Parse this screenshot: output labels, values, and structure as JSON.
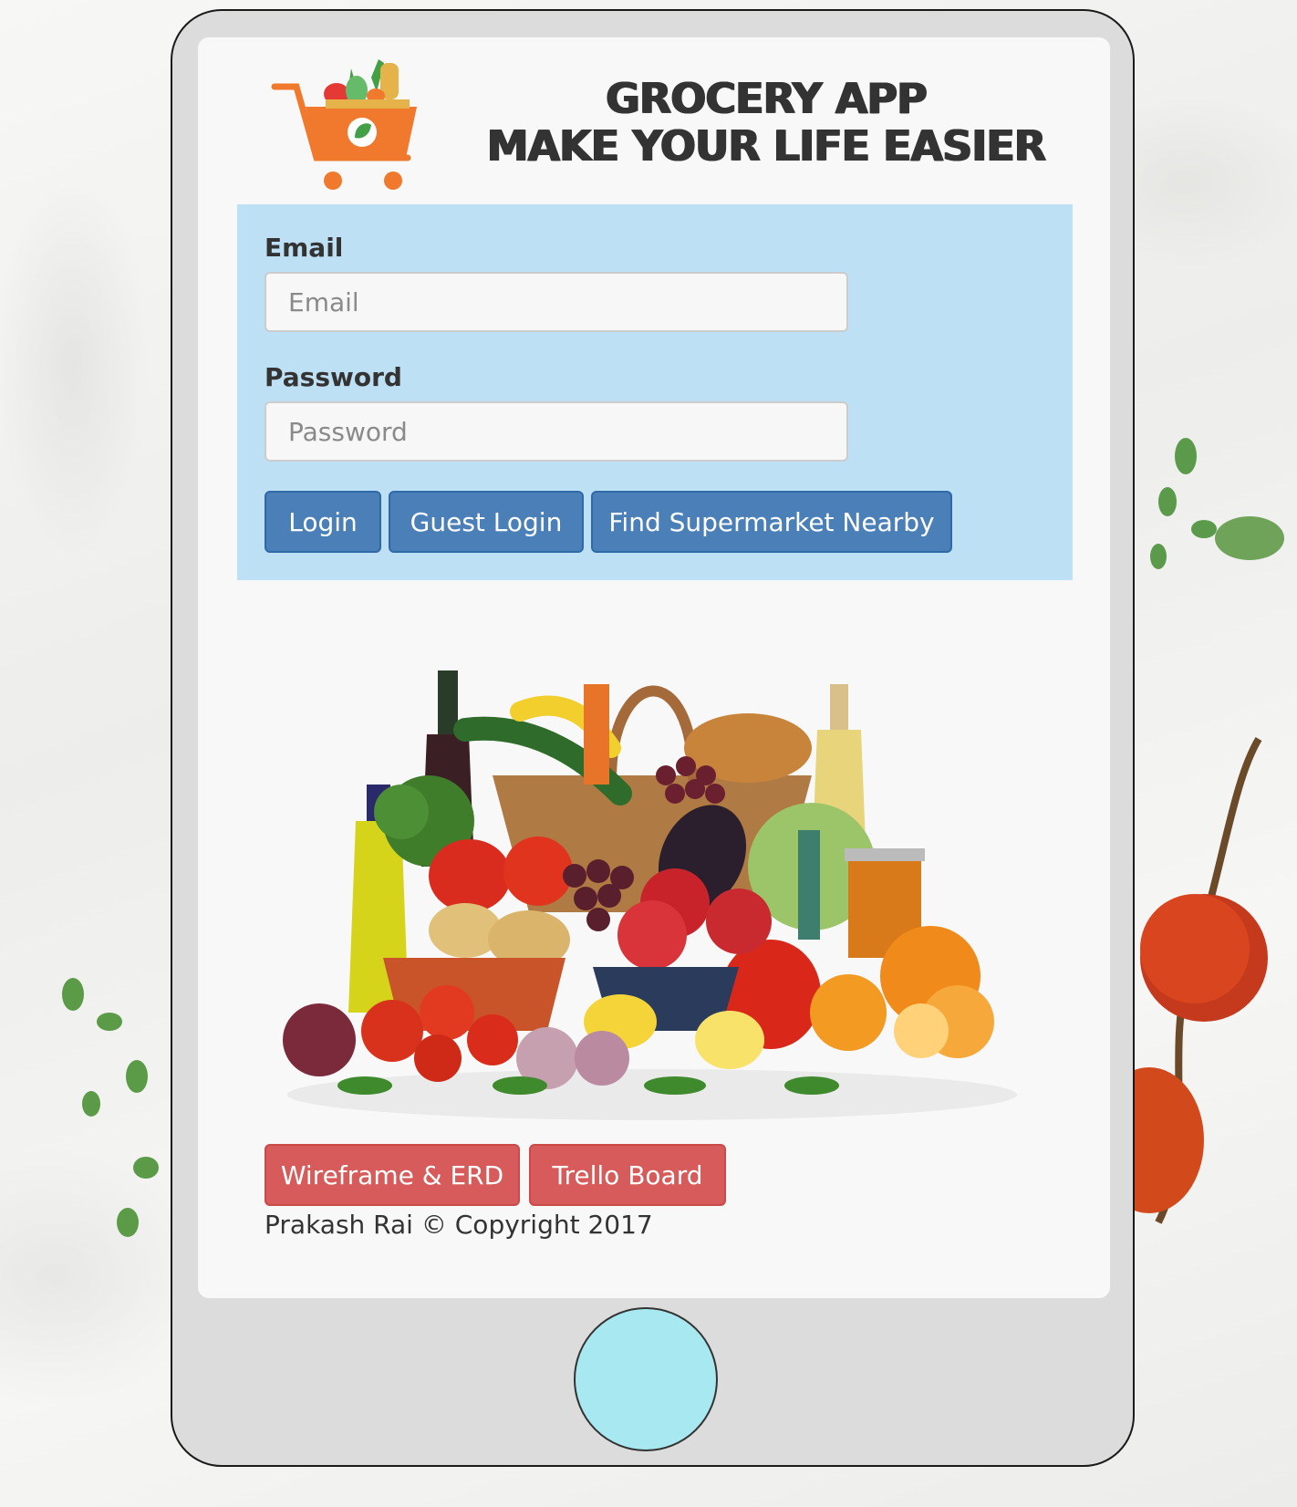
{
  "header": {
    "title_line1": "GROCERY APP",
    "title_line2": "MAKE YOUR LIFE EASIER"
  },
  "form": {
    "email_label": "Email",
    "email_placeholder": "Email",
    "password_label": "Password",
    "password_placeholder": "Password"
  },
  "buttons": {
    "login": "Login",
    "guest_login": "Guest Login",
    "find_supermarket": "Find Supermarket Nearby"
  },
  "footer": {
    "wireframe": "Wireframe & ERD",
    "trello": "Trello Board",
    "copyright": "Prakash Rai © Copyright 2017"
  },
  "colors": {
    "panel_bg": "#bde0f5",
    "primary_button": "#4a7fb8",
    "danger_button": "#d65b5a",
    "home_button": "#a8e8f0",
    "logo_orange": "#f0792d"
  },
  "icons": {
    "logo": "shopping-cart-icon",
    "home": "home-button"
  }
}
